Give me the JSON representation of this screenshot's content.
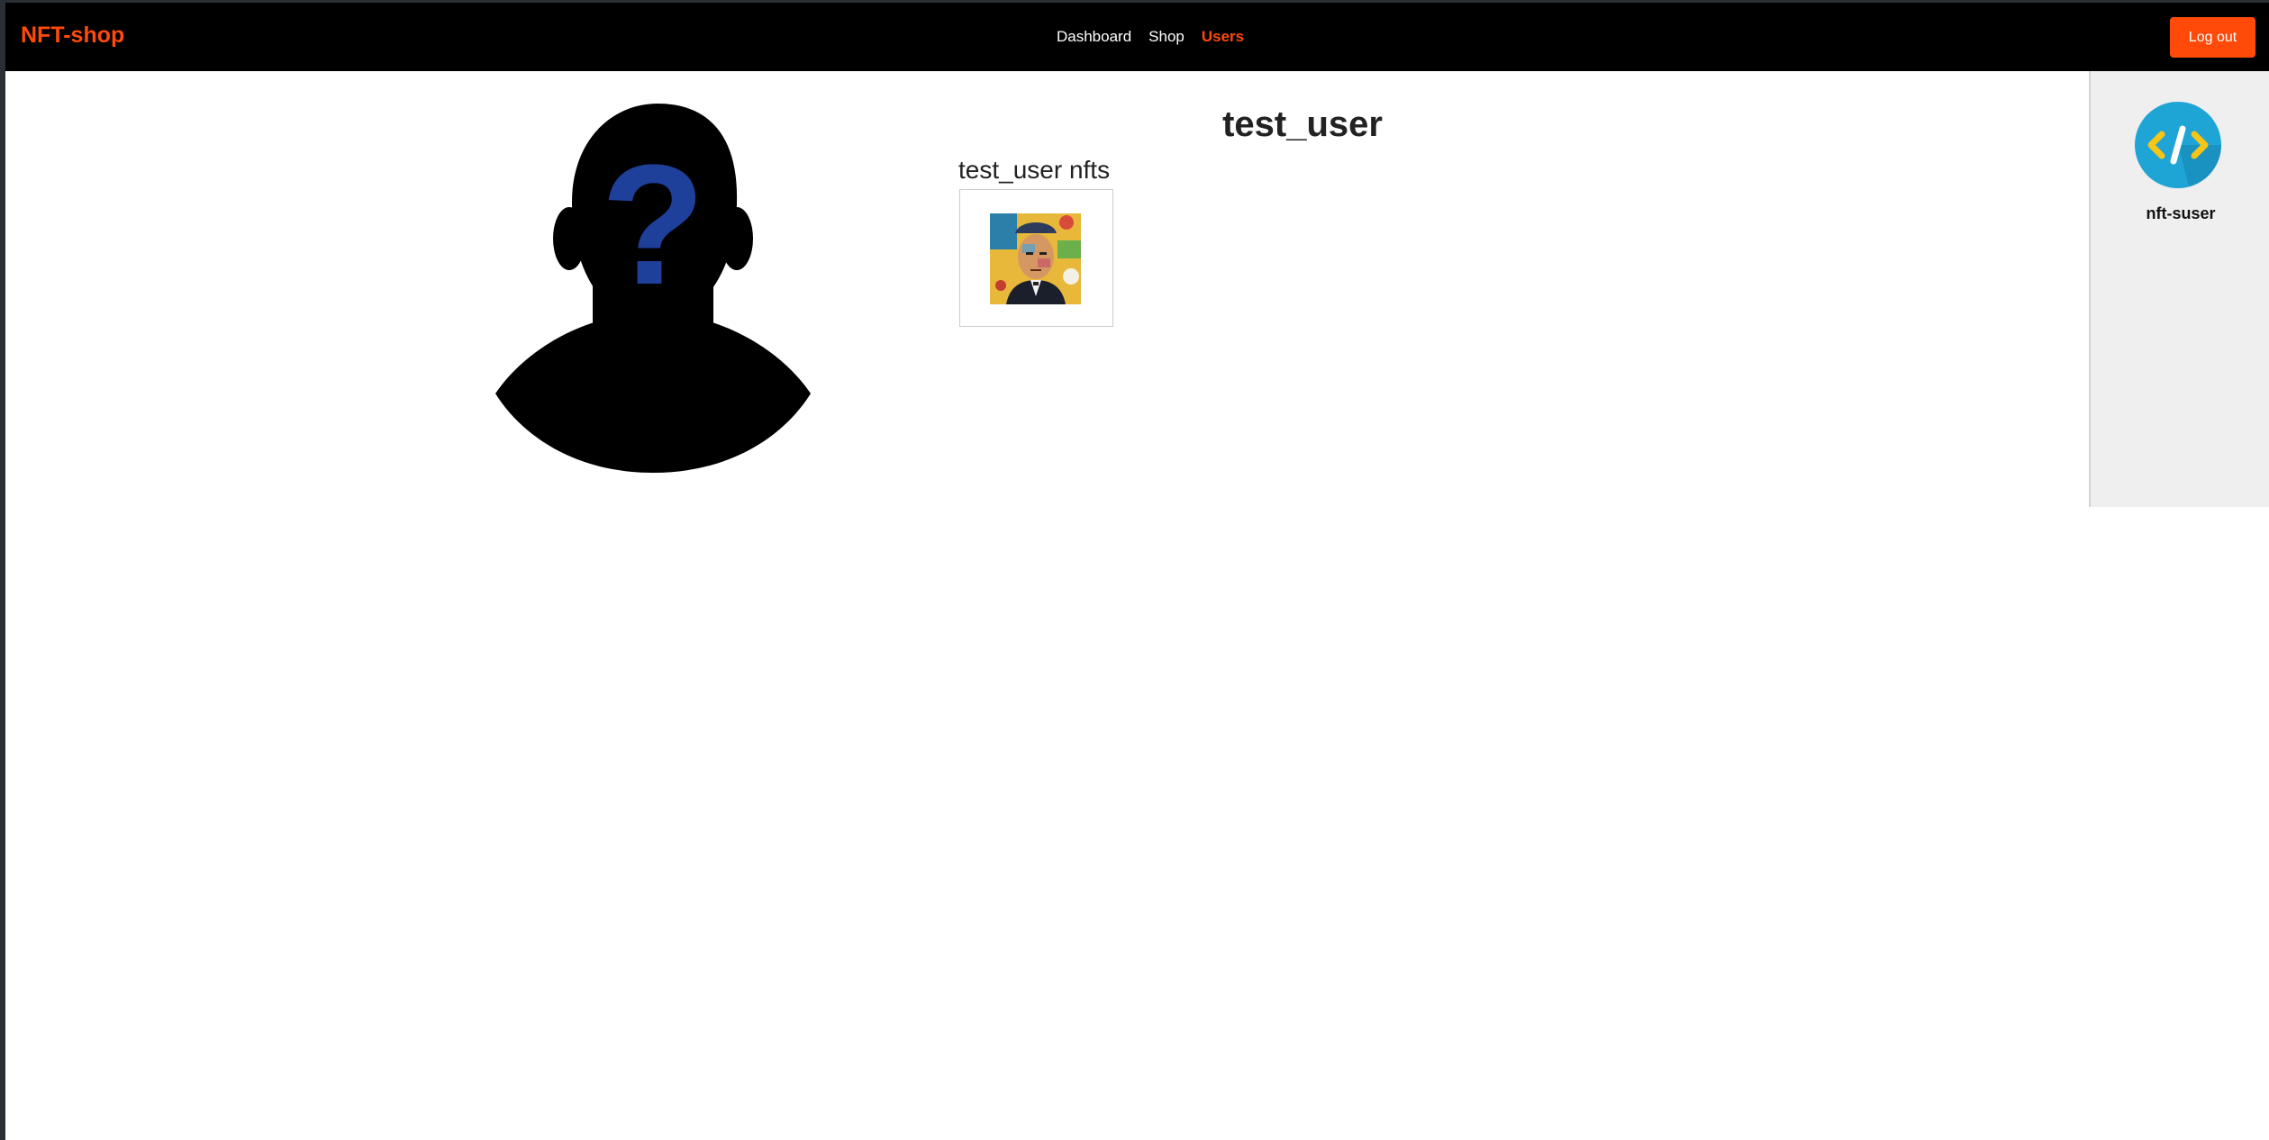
{
  "navbar": {
    "brand": "NFT-shop",
    "links": [
      {
        "label": "Dashboard",
        "active": false
      },
      {
        "label": "Shop",
        "active": false
      },
      {
        "label": "Users",
        "active": true
      }
    ],
    "logout_label": "Log out"
  },
  "profile": {
    "username": "test_user",
    "avatar_icon": "unknown-user-silhouette-icon",
    "nfts_heading": "test_user nfts",
    "nfts": [
      {
        "icon": "nft-portrait-artwork"
      }
    ]
  },
  "sidebar": {
    "users": [
      {
        "username": "nft-suser",
        "avatar_icon": "code-brackets-icon"
      }
    ]
  },
  "colors": {
    "accent": "#ff4a0a",
    "navbar_bg": "#000000",
    "sidebar_bg": "#efefef",
    "avatar_blue": "#1e3f9a",
    "side_avatar_bg": "#1fa4d6"
  }
}
